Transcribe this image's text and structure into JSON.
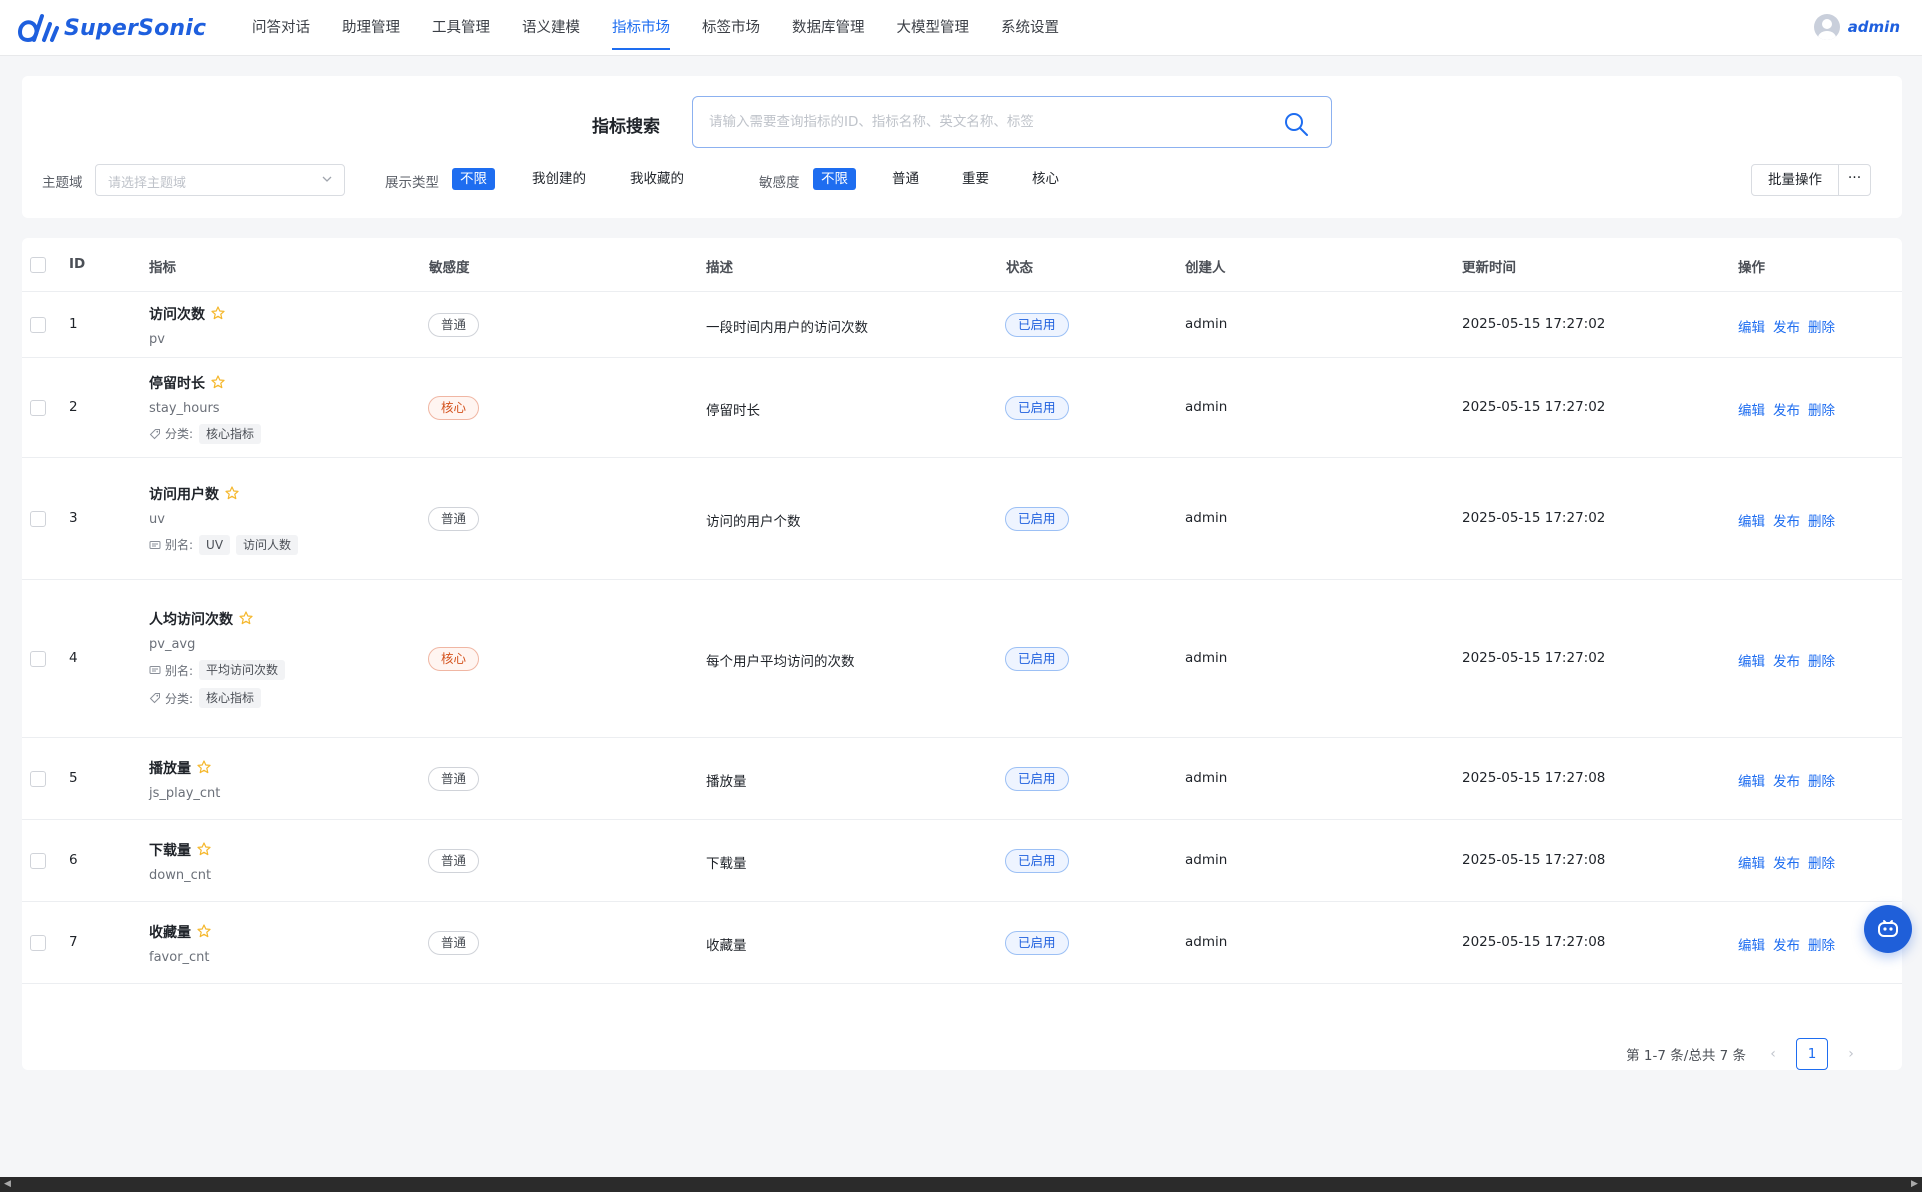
{
  "app": {
    "name": "SuperSonic",
    "user": "admin"
  },
  "nav": [
    {
      "label": "问答对话"
    },
    {
      "label": "助理管理"
    },
    {
      "label": "工具管理"
    },
    {
      "label": "语义建模"
    },
    {
      "label": "指标市场",
      "active": true
    },
    {
      "label": "标签市场"
    },
    {
      "label": "数据库管理"
    },
    {
      "label": "大模型管理"
    },
    {
      "label": "系统设置"
    }
  ],
  "search": {
    "title": "指标搜索",
    "placeholder": "请输入需要查询指标的ID、指标名称、英文名称、标签"
  },
  "filters": {
    "domain_label": "主题域",
    "domain_placeholder": "请选择主题域",
    "show_type_label": "展示类型",
    "show_type_options": [
      "不限",
      "我创建的",
      "我收藏的"
    ],
    "sensitivity_label": "敏感度",
    "sensitivity_options": [
      "不限",
      "普通",
      "重要",
      "核心"
    ],
    "batch_button": "批量操作",
    "more_button": "···"
  },
  "table": {
    "columns": [
      "ID",
      "指标",
      "敏感度",
      "描述",
      "状态",
      "创建人",
      "更新时间",
      "操作"
    ],
    "rows": [
      {
        "id": "1",
        "name": "访问次数",
        "biz": "pv",
        "sensitivity": "普通",
        "desc": "一段时间内用户的访问次数",
        "status": "已启用",
        "creator": "admin",
        "updated": "2025-05-15 17:27:02"
      },
      {
        "id": "2",
        "name": "停留时长",
        "biz": "stay_hours",
        "class_label": "分类:",
        "classes": [
          "核心指标"
        ],
        "sensitivity": "核心",
        "desc": "停留时长",
        "status": "已启用",
        "creator": "admin",
        "updated": "2025-05-15 17:27:02"
      },
      {
        "id": "3",
        "name": "访问用户数",
        "biz": "uv",
        "alias_label": "别名:",
        "aliases": [
          "UV",
          "访问人数"
        ],
        "sensitivity": "普通",
        "desc": "访问的用户个数",
        "status": "已启用",
        "creator": "admin",
        "updated": "2025-05-15 17:27:02"
      },
      {
        "id": "4",
        "name": "人均访问次数",
        "biz": "pv_avg",
        "alias_label": "别名:",
        "aliases": [
          "平均访问次数"
        ],
        "class_label": "分类:",
        "classes": [
          "核心指标"
        ],
        "sensitivity": "核心",
        "desc": "每个用户平均访问的次数",
        "status": "已启用",
        "creator": "admin",
        "updated": "2025-05-15 17:27:02"
      },
      {
        "id": "5",
        "name": "播放量",
        "biz": "js_play_cnt",
        "sensitivity": "普通",
        "desc": "播放量",
        "status": "已启用",
        "creator": "admin",
        "updated": "2025-05-15 17:27:08"
      },
      {
        "id": "6",
        "name": "下载量",
        "biz": "down_cnt",
        "sensitivity": "普通",
        "desc": "下载量",
        "status": "已启用",
        "creator": "admin",
        "updated": "2025-05-15 17:27:08"
      },
      {
        "id": "7",
        "name": "收藏量",
        "biz": "favor_cnt",
        "sensitivity": "普通",
        "desc": "收藏量",
        "status": "已启用",
        "creator": "admin",
        "updated": "2025-05-15 17:27:08"
      }
    ],
    "actions": [
      "编辑",
      "发布",
      "删除"
    ]
  },
  "pagination": {
    "total_text": "第 1-7 条/总共 7 条",
    "current": "1"
  },
  "colors": {
    "primary": "#1e6df0",
    "core": "#d4541f",
    "star": "#f5b72b"
  }
}
